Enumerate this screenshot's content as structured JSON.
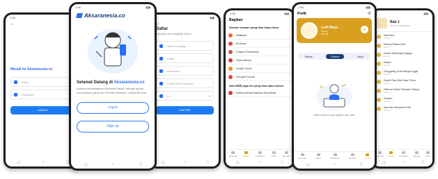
{
  "login": {
    "back": "←",
    "title": "Masuk ke Aksaranesia.co",
    "email_placeholder": "Email",
    "password_placeholder": "Password",
    "submit_label": "MASUK"
  },
  "welcome": {
    "logo_text": "Aksaranesia.co",
    "heading_prefix": "Selamat Datang di ",
    "heading_brand": "Aksaranesia.co",
    "body": "Aplikasi pembelajaran Bahasan Banjar sebagai upaya melestarikan generasi Gemilar Melelalui, Cakap Menulis.",
    "login_label": "Log in",
    "signup_label": "Sign up"
  },
  "register": {
    "back": "←",
    "title": "Daftar",
    "subtitle": "Lakukan dan lengkapi kolom",
    "fields": [
      "Nama Lengkap",
      "Email",
      "Password",
      "Konfirmasi Password",
      "Kelas"
    ],
    "select_value": "# 1",
    "submit_label": "DAFTAR"
  },
  "library": {
    "title": "Bagikan",
    "section1": "Sumber bacaan yang bisa kamu baca",
    "items": [
      {
        "label": "Wattpad",
        "color": "#f2693a"
      },
      {
        "label": "iPusnas",
        "color": "#e94a3c"
      },
      {
        "label": "Project Gutenberg",
        "color": "#c9563f"
      },
      {
        "label": "Story Bacaa",
        "color": "#d9372b"
      },
      {
        "label": "Kindle Cloud",
        "color": "#f08a2b"
      },
      {
        "label": "Google E-book",
        "color": "#e34a2f"
      }
    ],
    "section2": "Ada KBBI juga lho yang bisa kamu akses",
    "kbbi_item": {
      "label": "Kamus Besar Bahasa Indonesia",
      "color": "#d63b30"
    },
    "nav": [
      "Beranda",
      "Materi",
      "Praktikum",
      "Profil",
      "Bacaan"
    ]
  },
  "profile": {
    "title": "Profil",
    "name": "Lutfi Bayu",
    "role": "Kelas 3",
    "stat": "Skor 80",
    "tabs": [
      "Status",
      "Tulisan",
      "Buku"
    ],
    "active_tab": "Tulisan",
    "empty_text": "Kamu belum ada tulisan nih, yuk!",
    "nav": [
      "Beranda",
      "Materi",
      "Praktikum",
      "Bacaan",
      "Profil"
    ]
  },
  "chapters": {
    "title": "Bab 1",
    "subtitle": "PANTUN INDONESIA",
    "items": [
      "Ada Aku",
      "Nenny Riska Sari",
      "Andra Rahmaja Wijaya",
      "Nadia",
      "Ginggang Duta Mega Inggit",
      "Kasih Ras Wei Maw Thea",
      "Rahma Nada Fauwaz Sabya",
      "Saidun",
      "Ada Aku Benaria Putri"
    ],
    "item_sub": "Pantun",
    "nav": [
      "Beranda",
      "Materi",
      "Praktikum",
      "Bacaan",
      "Profil"
    ]
  },
  "system_nav": [
    "◁",
    "○",
    "□"
  ],
  "status_time": "1:58",
  "colors": {
    "primary": "#1e7cf2",
    "accent": "#e7b434",
    "profile_header": "#d9a020"
  }
}
